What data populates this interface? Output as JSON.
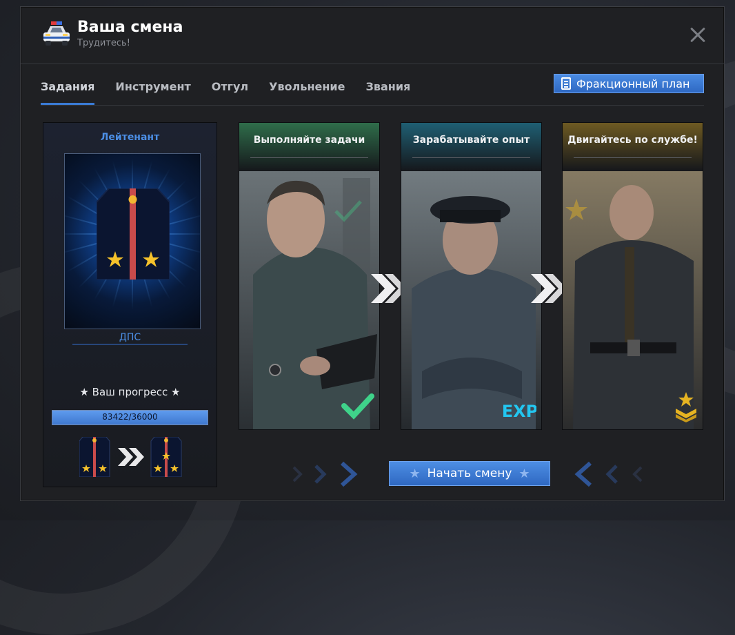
{
  "window": {
    "title": "Ваша смена",
    "subtitle": "Трудитесь!"
  },
  "tabs": [
    {
      "label": "Задания",
      "active": true
    },
    {
      "label": "Инструмент",
      "active": false
    },
    {
      "label": "Отгул",
      "active": false
    },
    {
      "label": "Увольнение",
      "active": false
    },
    {
      "label": "Звания",
      "active": false
    }
  ],
  "plan_button": {
    "label": "Фракционный план"
  },
  "rank_panel": {
    "rank_name": "Лейтенант",
    "unit": "ДПС",
    "progress_label": "★ Ваш прогресс ★",
    "progress_text": "83422/36000",
    "progress_fraction": 1.0
  },
  "cards": [
    {
      "title": "Выполняйте задачи",
      "accent": "#2f6d4a",
      "badge": "check"
    },
    {
      "title": "Зарабатывайте опыт",
      "accent": "#1f5f73",
      "badge": "EXP"
    },
    {
      "title": "Двигайтесь по службе!",
      "accent": "#6e5a22",
      "badge": "rank"
    }
  ],
  "start_button": {
    "label": "Начать смену"
  },
  "colors": {
    "accent_blue": "#3a7bd5",
    "check_green": "#3fd38a",
    "exp_cyan": "#23c6f0",
    "gold": "#e6b422"
  }
}
